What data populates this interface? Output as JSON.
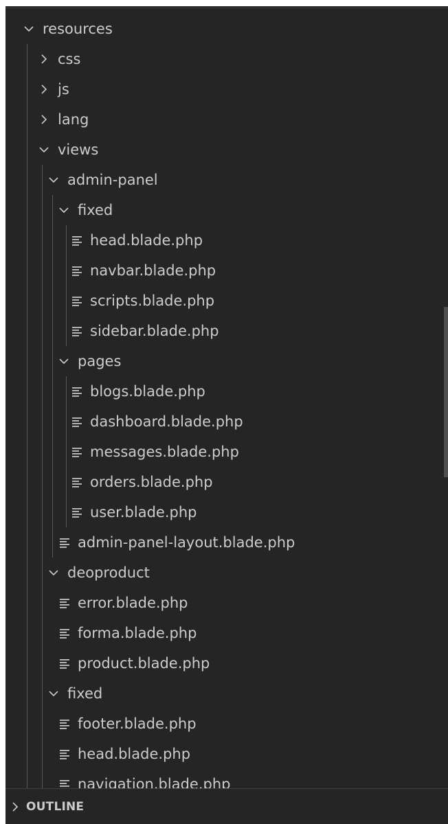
{
  "explorer": {
    "rows": [
      {
        "label": "resources",
        "kind": "folder",
        "expanded": true,
        "depth": 0
      },
      {
        "label": "css",
        "kind": "folder",
        "expanded": false,
        "depth": 1
      },
      {
        "label": "js",
        "kind": "folder",
        "expanded": false,
        "depth": 1
      },
      {
        "label": "lang",
        "kind": "folder",
        "expanded": false,
        "depth": 1
      },
      {
        "label": "views",
        "kind": "folder",
        "expanded": true,
        "depth": 1
      },
      {
        "label": "admin-panel",
        "kind": "folder",
        "expanded": true,
        "depth": 2
      },
      {
        "label": "fixed",
        "kind": "folder",
        "expanded": true,
        "depth": 3
      },
      {
        "label": "head.blade.php",
        "kind": "file",
        "depth": 4
      },
      {
        "label": "navbar.blade.php",
        "kind": "file",
        "depth": 4
      },
      {
        "label": "scripts.blade.php",
        "kind": "file",
        "depth": 4
      },
      {
        "label": "sidebar.blade.php",
        "kind": "file",
        "depth": 4
      },
      {
        "label": "pages",
        "kind": "folder",
        "expanded": true,
        "depth": 3
      },
      {
        "label": "blogs.blade.php",
        "kind": "file",
        "depth": 4
      },
      {
        "label": "dashboard.blade.php",
        "kind": "file",
        "depth": 4
      },
      {
        "label": "messages.blade.php",
        "kind": "file",
        "depth": 4
      },
      {
        "label": "orders.blade.php",
        "kind": "file",
        "depth": 4
      },
      {
        "label": "user.blade.php",
        "kind": "file",
        "depth": 4
      },
      {
        "label": "admin-panel-layout.blade.php",
        "kind": "file",
        "depth": 3
      },
      {
        "label": "deoproduct",
        "kind": "folder",
        "expanded": true,
        "depth": 2
      },
      {
        "label": "error.blade.php",
        "kind": "file",
        "depth": 3
      },
      {
        "label": "forma.blade.php",
        "kind": "file",
        "depth": 3
      },
      {
        "label": "product.blade.php",
        "kind": "file",
        "depth": 3
      },
      {
        "label": "fixed",
        "kind": "folder",
        "expanded": true,
        "depth": 2
      },
      {
        "label": "footer.blade.php",
        "kind": "file",
        "depth": 3
      },
      {
        "label": "head.blade.php",
        "kind": "file",
        "depth": 3
      },
      {
        "label": "navigation.blade.php",
        "kind": "file",
        "depth": 3
      }
    ]
  },
  "outline": {
    "label": "OUTLINE",
    "expanded": false
  },
  "colors": {
    "background": "#252526",
    "text": "#cccccc",
    "guide": "#585858",
    "scrollbar": "#4f4f4f"
  },
  "icons": {
    "expanded": "chevron-down-icon",
    "collapsed": "chevron-right-icon",
    "file": "lines-file-icon"
  }
}
